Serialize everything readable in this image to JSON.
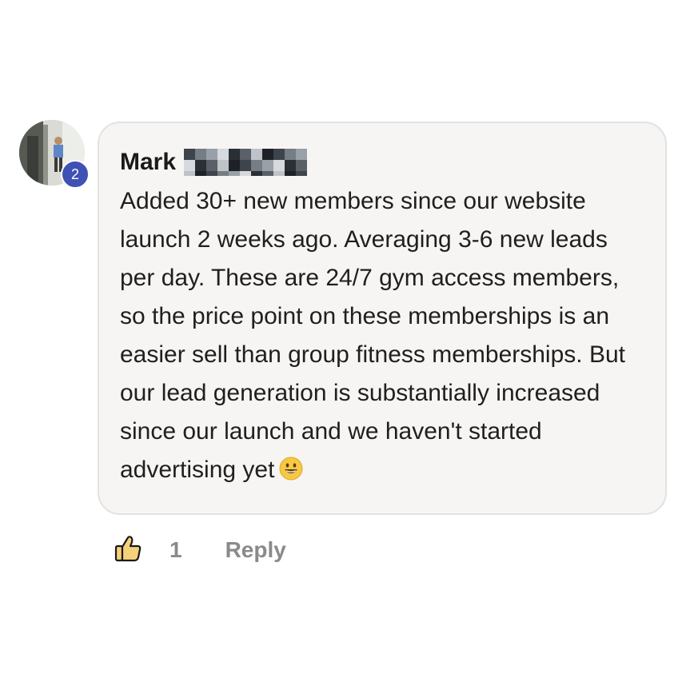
{
  "comment": {
    "author_name": "Mark",
    "author_badge": "2",
    "body": "Added 30+ new members since our website launch 2 weeks ago. Averaging 3-6 new leads per day. These are 24/7 gym access members, so the price point on these memberships is an easier sell than group fitness memberships. But our lead generation is substantially increased since our launch and we haven't started advertising yet",
    "emoji": "grinning-face",
    "like_count": "1",
    "reply_label": "Reply"
  },
  "colors": {
    "badge": "#3f51b5",
    "bubble_bg": "#f6f5f3",
    "bubble_border": "#e2e2e2",
    "muted_text": "#8a8a8a",
    "like_icon_fill": "#f5d27a"
  },
  "icons": {
    "like": "thumbs-up-icon",
    "emoji": "grinning-face-icon"
  }
}
